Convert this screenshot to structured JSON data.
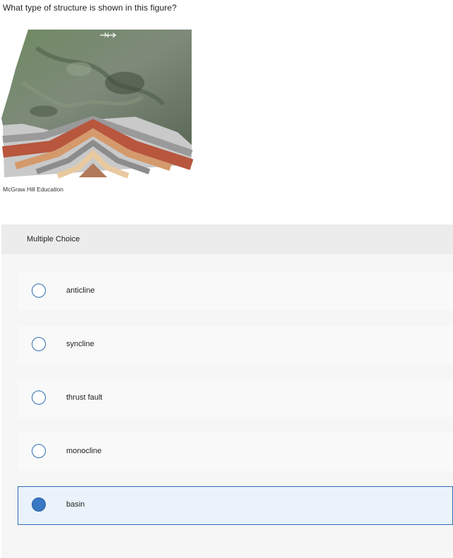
{
  "question": "What type of structure is shown in this figure?",
  "figure": {
    "arrow_label": "N",
    "credit": "McGraw Hill Education"
  },
  "panel": {
    "title": "Multiple Choice",
    "choices": [
      {
        "label": "anticline",
        "selected": false
      },
      {
        "label": "syncline",
        "selected": false
      },
      {
        "label": "thrust fault",
        "selected": false
      },
      {
        "label": "monocline",
        "selected": false
      },
      {
        "label": "basin",
        "selected": true
      }
    ]
  },
  "colors": {
    "accent": "#2e6db4",
    "selected_bg": "#eaf3fc"
  }
}
